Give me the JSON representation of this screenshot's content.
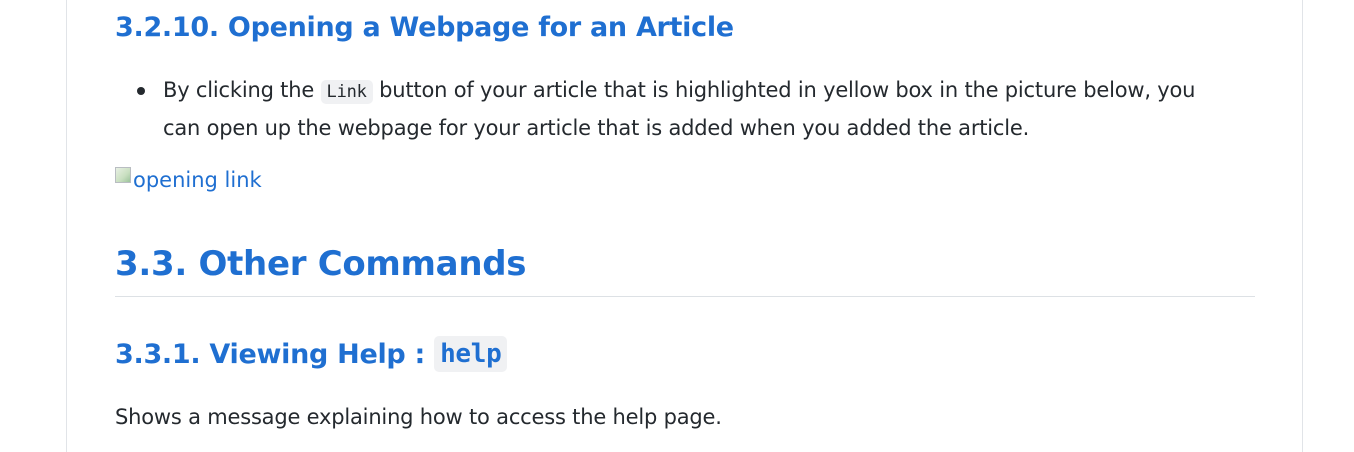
{
  "section_3210": {
    "heading": "3.2.10. Opening a Webpage for an Article",
    "bullet": {
      "text_before": "By clicking the ",
      "code": "Link",
      "text_after_line1": " button of your article that is highlighted in yellow box in the picture below, you",
      "text_line2": "can open up the webpage for your article that is added when you added the article."
    },
    "image_alt": "opening link"
  },
  "section_33": {
    "heading": "3.3. Other Commands"
  },
  "section_331": {
    "heading_text": "3.3.1. Viewing Help : ",
    "heading_code": "help",
    "paragraph": "Shows a message explaining how to access the help page."
  },
  "colors": {
    "heading": "#1f6fd1",
    "text": "#24292e",
    "code_bg": "#f0f1f3",
    "rule": "#dde1e5"
  }
}
